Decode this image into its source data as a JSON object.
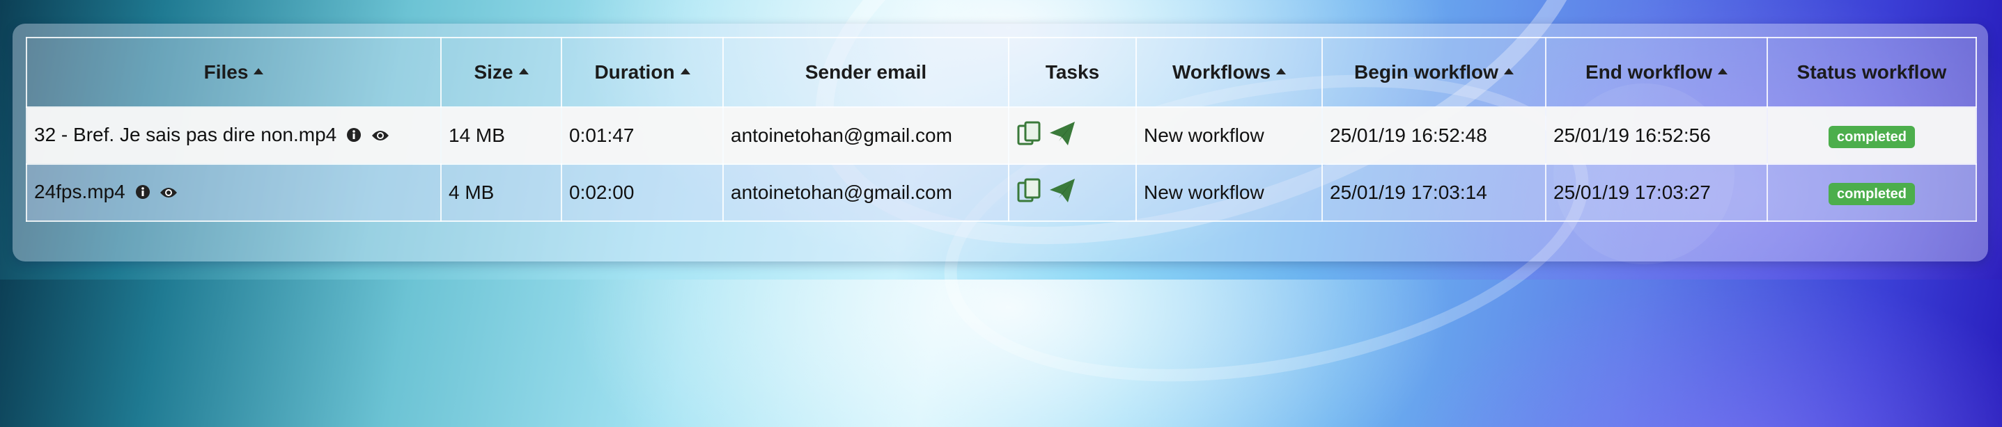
{
  "columns": [
    {
      "label": "Files",
      "sortable": true
    },
    {
      "label": "Size",
      "sortable": true
    },
    {
      "label": "Duration",
      "sortable": true
    },
    {
      "label": "Sender email",
      "sortable": false
    },
    {
      "label": "Tasks",
      "sortable": false
    },
    {
      "label": "Workflows",
      "sortable": true
    },
    {
      "label": "Begin workflow",
      "sortable": true
    },
    {
      "label": "End workflow",
      "sortable": true
    },
    {
      "label": "Status workflow",
      "sortable": false
    }
  ],
  "rows": [
    {
      "file": "32 - Bref. Je sais pas dire non.mp4",
      "size": "14 MB",
      "duration": "0:01:47",
      "sender_email": "antoinetohan@gmail.com",
      "task_icons": [
        "copy-files-icon",
        "send-icon"
      ],
      "workflow": "New workflow",
      "begin": "25/01/19 16:52:48",
      "end": "25/01/19 16:52:56",
      "status": "completed"
    },
    {
      "file": "24fps.mp4",
      "size": "4 MB",
      "duration": "0:02:00",
      "sender_email": "antoinetohan@gmail.com",
      "task_icons": [
        "copy-files-icon",
        "send-icon"
      ],
      "workflow": "New workflow",
      "begin": "25/01/19 17:03:14",
      "end": "25/01/19 17:03:27",
      "status": "completed"
    }
  ],
  "colors": {
    "status_completed": "#4cae4c",
    "task_icon": "#3a7a3a"
  }
}
